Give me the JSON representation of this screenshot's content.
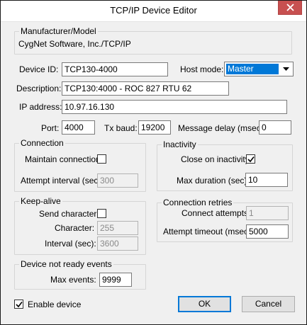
{
  "window": {
    "title": "TCP/IP Device Editor"
  },
  "manufacturer": {
    "group_label": "Manufacturer/Model",
    "value": "CygNet Software, Inc./TCP/IP"
  },
  "device": {
    "id_label": "Device ID:",
    "id_value": "TCP130-4000",
    "host_mode_label": "Host mode:",
    "host_mode_value": "Master",
    "description_label": "Description:",
    "description_value": "TCP130:4000 - ROC 827 RTU 62",
    "ip_label": "IP address:",
    "ip_value": "10.97.16.130",
    "port_label": "Port:",
    "port_value": "4000",
    "tx_baud_label": "Tx baud:",
    "tx_baud_value": "19200",
    "msg_delay_label": "Message delay (msec):",
    "msg_delay_value": "0"
  },
  "connection": {
    "group_label": "Connection",
    "maintain_label": "Maintain connection",
    "maintain_checked": false,
    "attempt_interval_label": "Attempt interval (sec):",
    "attempt_interval_value": "300"
  },
  "inactivity": {
    "group_label": "Inactivity",
    "close_label": "Close on inactivity",
    "close_checked": true,
    "max_duration_label": "Max duration (sec):",
    "max_duration_value": "10"
  },
  "keepalive": {
    "group_label": "Keep-alive",
    "send_char_label": "Send character",
    "send_char_checked": false,
    "character_label": "Character:",
    "character_value": "255",
    "interval_label": "Interval (sec):",
    "interval_value": "3600"
  },
  "retries": {
    "group_label": "Connection retries",
    "attempts_label": "Connect attempts:",
    "attempts_value": "1",
    "timeout_label": "Attempt timeout (msec):",
    "timeout_value": "5000"
  },
  "not_ready": {
    "group_label": "Device not ready events",
    "max_events_label": "Max events:",
    "max_events_value": "9999"
  },
  "footer": {
    "enable_label": "Enable device",
    "enable_checked": true,
    "ok_label": "OK",
    "cancel_label": "Cancel"
  },
  "icons": {
    "close": "close-icon",
    "check": "checkmark-icon",
    "dropdown": "chevron-down-icon"
  },
  "colors": {
    "selection": "#0078d7",
    "close_button": "#c75050",
    "dialog_bg": "#f0f0f0"
  }
}
